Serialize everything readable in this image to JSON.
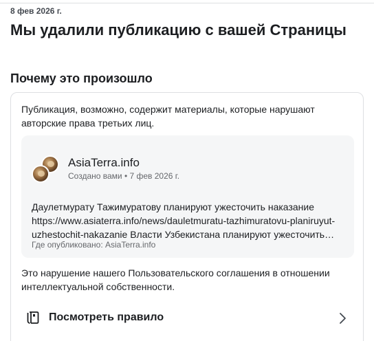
{
  "header": {
    "date": "8 фев 2026 г.",
    "title": "Мы удалили публикацию с вашей Страницы"
  },
  "section": {
    "title": "Почему это произошло"
  },
  "card": {
    "reason": "Публикация, возможно, содержит материалы, которые нарушают авторские права третьих лиц.",
    "post": {
      "page_name": "AsiaTerra.info",
      "meta": "Создано вами • 7 фев 2026 г.",
      "text": "Даулетмурату Тажимуратову планируют ужесточить наказание https://www.asiaterra.info/news/dauletmuratu-tazhimuratovu-planiruyut-uzhestochit-nakazanie Власти Узбекистана планируют ужесточить наказание",
      "published": "Где опубликовано: AsiaTerra.info"
    },
    "violation": "Это нарушение нашего Пользовательского соглашения в отношении интеллектуальной собственности.",
    "rule_link": {
      "label": "Посмотреть правило",
      "icon": "book-icon"
    }
  },
  "colors": {
    "text_primary": "#1c1e21",
    "text_secondary": "#65676b",
    "post_background": "#f5f6f7",
    "border": "#dddfe2"
  }
}
